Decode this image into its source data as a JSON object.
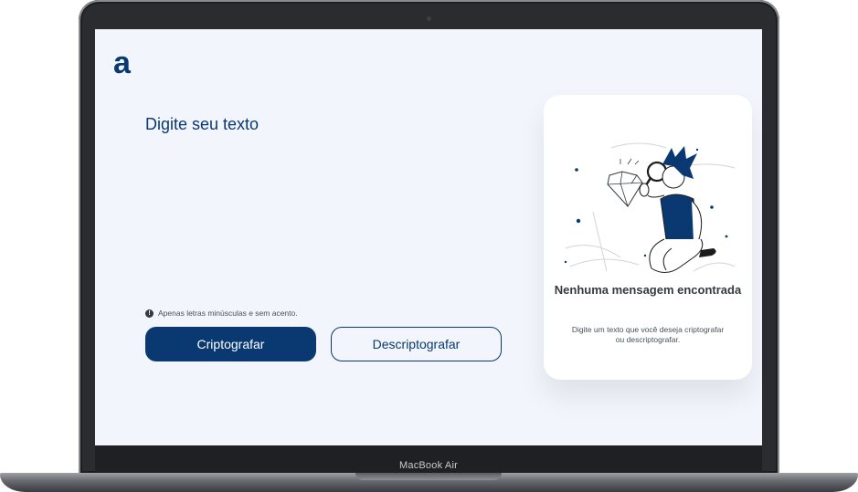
{
  "device": {
    "label": "MacBook Air"
  },
  "app": {
    "logo_glyph": "a",
    "input_placeholder": "Digite seu texto",
    "hint_text": "Apenas letras minúsculas e sem acento.",
    "encrypt_label": "Criptografar",
    "decrypt_label": "Descriptografar",
    "accent_color": "#0a3871"
  },
  "output": {
    "title": "Nenhuma mensagem encontrada",
    "description": "Digite um texto que você deseja criptografar ou descriptografar."
  }
}
